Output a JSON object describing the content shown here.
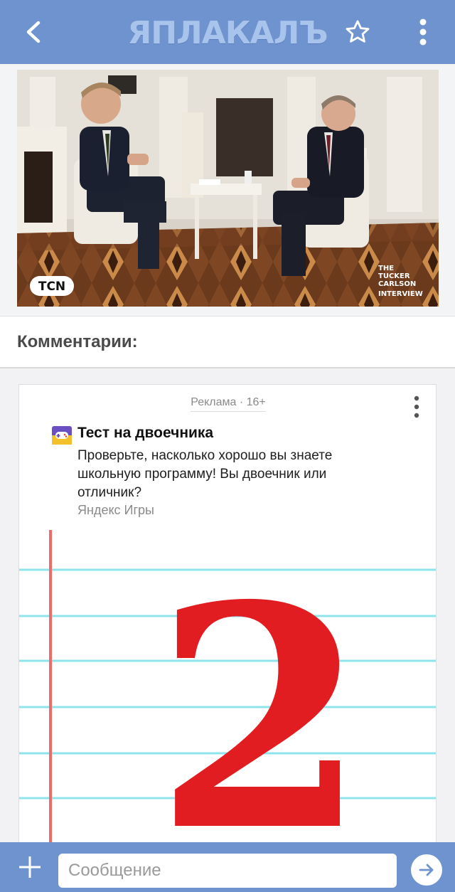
{
  "header": {
    "logo_text": "ЯПЛАКАЛЪ",
    "back_icon": "back-arrow-icon",
    "favorite_icon": "star-icon",
    "menu_icon": "more-vertical-icon"
  },
  "post": {
    "image_overlay_logo": "TCN",
    "image_overlay_caption": [
      "THE",
      "TUCKER",
      "CARLSON",
      "INTERVIEW"
    ]
  },
  "comments": {
    "title": "Комментарии:"
  },
  "ad": {
    "label": "Реклама · 16+",
    "title": "Тест на двоечника",
    "text": "Проверьте, насколько хорошо вы знаете школьную программу! Вы двоечник или отличник?",
    "source": "Яндекс Игры",
    "image_digit": "2",
    "menu_icon": "more-vertical-icon",
    "game_icon": "gamepad-icon"
  },
  "composer": {
    "placeholder": "Сообщение",
    "value": "",
    "add_icon": "plus-icon",
    "send_icon": "arrow-right-icon"
  },
  "colors": {
    "brand": "#6e93cf",
    "logo": "#a9c4ec",
    "ad_digit": "#e11d22",
    "notebook_line": "#8fe3ea",
    "margin_line": "#f06a6a"
  }
}
